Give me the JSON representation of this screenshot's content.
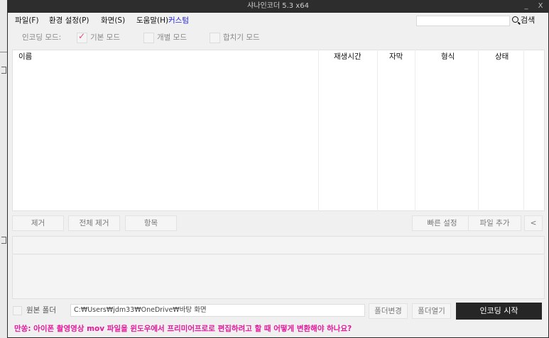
{
  "window": {
    "title": "샤나인코더 5.3 x64",
    "minimize_label": "_",
    "close_label": "X"
  },
  "menu": {
    "file": "파일(F)",
    "env": "환경 설정(P)",
    "view": "화면(S)",
    "help": "도움말(H)",
    "custom": "커스텀"
  },
  "search": {
    "value": "",
    "button_label": "검색"
  },
  "mode": {
    "label": "인코딩 모드:",
    "options": [
      {
        "label": "기본 모드",
        "checked": true
      },
      {
        "label": "개별 모드",
        "checked": false
      },
      {
        "label": "합치기 모드",
        "checked": false
      }
    ]
  },
  "list": {
    "columns": [
      "이름",
      "재생시간",
      "자막",
      "형식",
      "상태"
    ]
  },
  "buttons": {
    "remove": "제거",
    "remove_all": "전체 제거",
    "items": "항목",
    "quick_settings": "빠른 설정",
    "add_file": "파일 추가",
    "collapse": "<"
  },
  "bottom": {
    "source_folder_label": "원본 폴더",
    "source_folder_checked": false,
    "path": "C:₩Users₩jdm33₩OneDrive₩바탕 화면",
    "change_folder": "폴더변경",
    "open_folder": "폴더열기",
    "start": "인코딩 시작"
  },
  "notice": "만쏭: 아이폰 촬영영상 mov 파일을 윈도우에서 프리미어프로로 편집하려고 할 때 어떻게 변환해야 하나요?",
  "colors": {
    "accent": "#e5199c",
    "custom_menu": "#2020d8",
    "titlebar": "#2d2d2d",
    "start_button": "#262626"
  }
}
